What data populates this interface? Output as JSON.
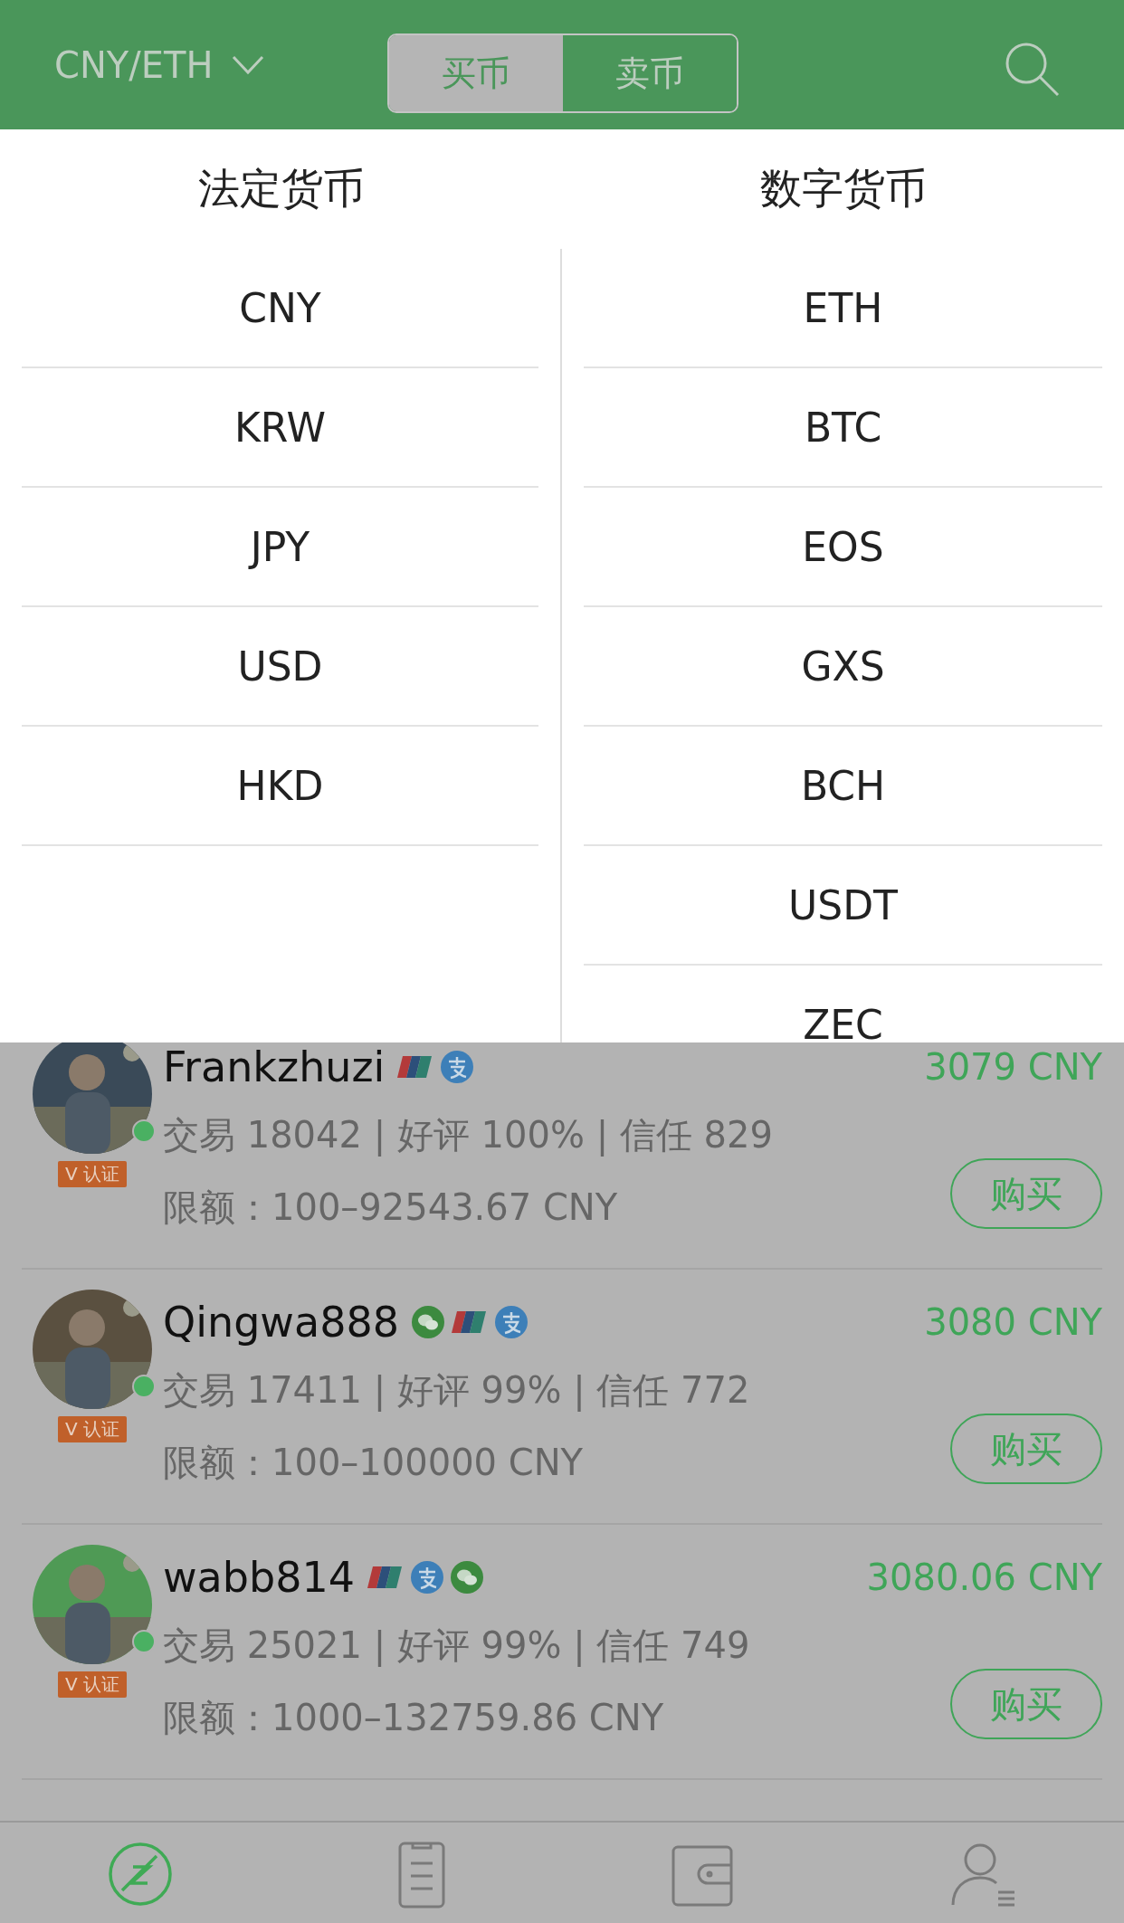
{
  "header": {
    "pair": "CNY/ETH",
    "tabs": [
      {
        "label": "买币",
        "selected": true
      },
      {
        "label": "卖币",
        "selected": false
      }
    ]
  },
  "currency_picker": {
    "columns": [
      {
        "title": "法定货币",
        "items": [
          {
            "label": "CNY"
          },
          {
            "label": "KRW"
          },
          {
            "label": "JPY"
          },
          {
            "label": "USD"
          },
          {
            "label": "HKD"
          }
        ]
      },
      {
        "title": "数字货币",
        "items": [
          {
            "label": "ETH"
          },
          {
            "label": "BTC"
          },
          {
            "label": "EOS"
          },
          {
            "label": "GXS"
          },
          {
            "label": "BCH"
          },
          {
            "label": "USDT"
          },
          {
            "label": "ZEC"
          }
        ]
      }
    ]
  },
  "offers": [
    {
      "name": "Frankzhuzi",
      "online": true,
      "badge": "V 认证",
      "payments": [
        {
          "kind": "unionpay"
        },
        {
          "kind": "alipay"
        }
      ],
      "price": "3079 CNY",
      "stats": "交易 18042 | 好评 100% | 信任 829",
      "limit": "限额：100–92543.67 CNY",
      "action": "购买"
    },
    {
      "name": "Qingwa888",
      "online": true,
      "badge": "V 认证",
      "payments": [
        {
          "kind": "wechat"
        },
        {
          "kind": "unionpay"
        },
        {
          "kind": "alipay"
        }
      ],
      "price": "3080 CNY",
      "stats": "交易 17411 | 好评 99% | 信任 772",
      "limit": "限额：100–100000 CNY",
      "action": "购买"
    },
    {
      "name": "wabb814",
      "online": true,
      "badge": "V 认证",
      "payments": [
        {
          "kind": "unionpay"
        },
        {
          "kind": "alipay"
        },
        {
          "kind": "wechat"
        }
      ],
      "price": "3080.06 CNY",
      "stats": "交易 25021 | 好评 99% | 信任 749",
      "limit": "限额：1000–132759.86 CNY",
      "action": "购买"
    }
  ],
  "bottom_nav": [
    {
      "kind": "home",
      "selected": true
    },
    {
      "kind": "orders",
      "selected": false
    },
    {
      "kind": "wallet",
      "selected": false
    },
    {
      "kind": "profile",
      "selected": false
    }
  ]
}
